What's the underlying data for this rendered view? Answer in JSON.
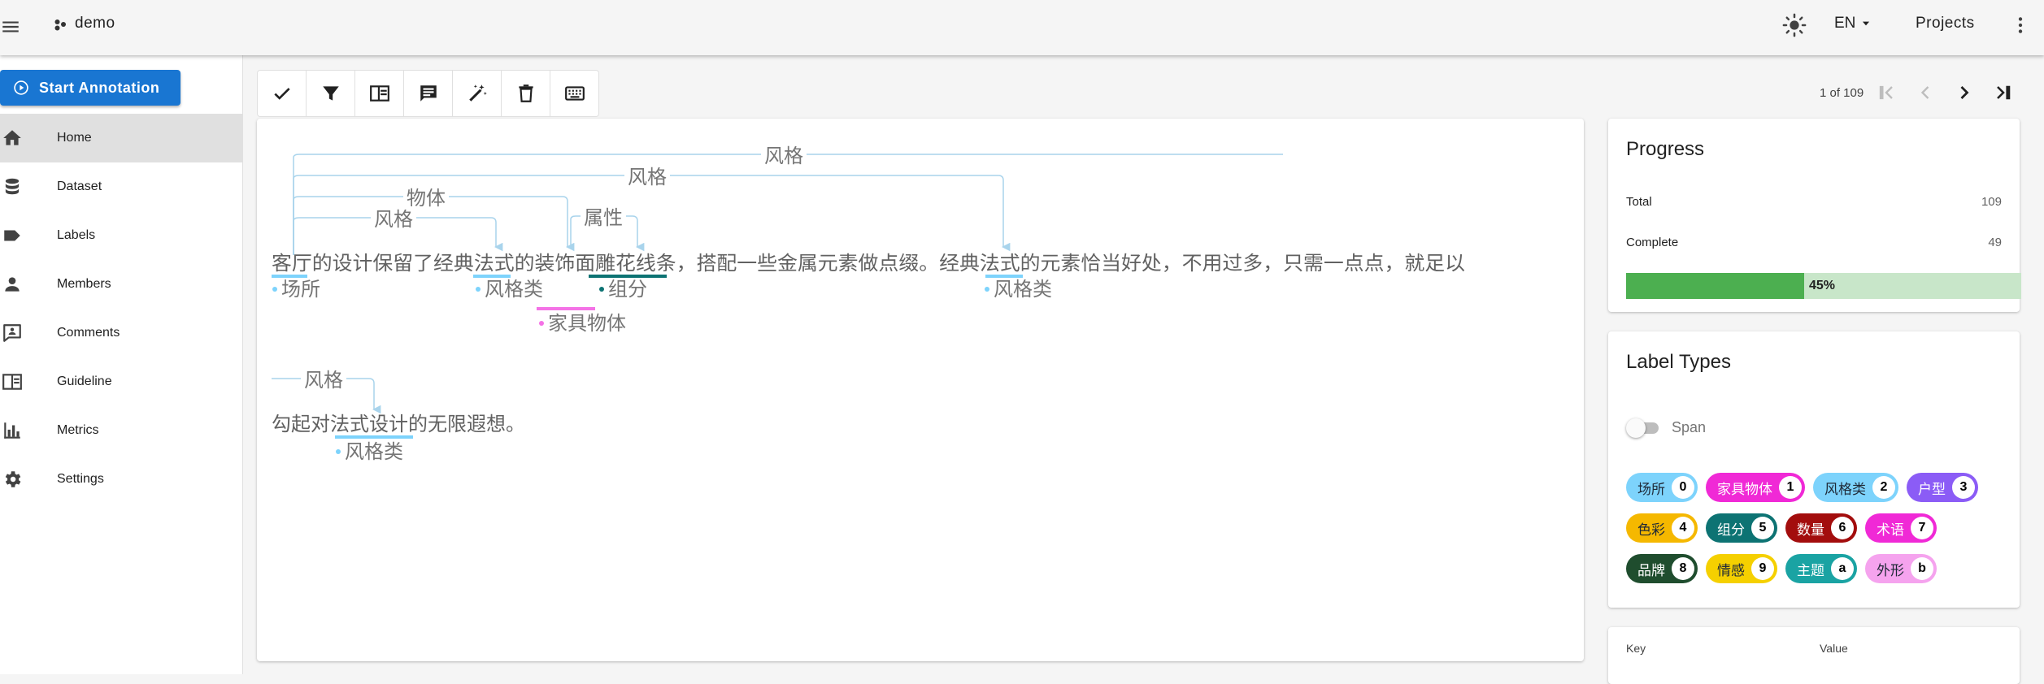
{
  "app": {
    "name": "demo"
  },
  "header": {
    "language": "EN",
    "projects_label": "Projects"
  },
  "sidebar": {
    "start_button": "Start Annotation",
    "items": [
      {
        "label": "Home",
        "icon": "home-icon",
        "active": true
      },
      {
        "label": "Dataset",
        "icon": "database-icon"
      },
      {
        "label": "Labels",
        "icon": "label-icon"
      },
      {
        "label": "Members",
        "icon": "person-icon"
      },
      {
        "label": "Comments",
        "icon": "comment-icon"
      },
      {
        "label": "Guideline",
        "icon": "book-icon"
      },
      {
        "label": "Metrics",
        "icon": "chart-icon"
      },
      {
        "label": "Settings",
        "icon": "gear-icon"
      }
    ]
  },
  "toolbar": {
    "tools": [
      "check-icon",
      "filter-icon",
      "layout-icon",
      "comment-icon",
      "auto-label-icon",
      "delete-icon",
      "keyboard-icon"
    ]
  },
  "pager": {
    "text": "1 of 109"
  },
  "document": {
    "line1": "客厅的设计保留了经典法式的装饰面雕花线条，搭配一些金属元素做点缀。经典法式的元素恰当好处，不用过多，只需一点点，就足以",
    "line2": "勾起对法式设计的无限遐想。",
    "spans": [
      {
        "text": "客厅",
        "label": "场所",
        "color": "#7dd3fc"
      },
      {
        "text": "法式",
        "label": "风格类",
        "color": "#7dd3fc"
      },
      {
        "text": "装饰面",
        "label": "家具物体",
        "color": "#f472e6"
      },
      {
        "text": "雕花线条",
        "label": "组分",
        "color": "#0d7373"
      },
      {
        "text": "法式",
        "label": "风格类",
        "color": "#7dd3fc"
      },
      {
        "text": "法式设计",
        "label": "风格类",
        "color": "#7dd3fc"
      }
    ],
    "relations": [
      {
        "label": "风格"
      },
      {
        "label": "风格"
      },
      {
        "label": "物体"
      },
      {
        "label": "风格"
      },
      {
        "label": "属性"
      },
      {
        "label": "风格"
      }
    ]
  },
  "progress": {
    "title": "Progress",
    "total_label": "Total",
    "total_value": "109",
    "complete_label": "Complete",
    "complete_value": "49",
    "percent": 45,
    "percent_label": "45%",
    "fill_color": "#4caf50",
    "track_color": "#c8e6c9"
  },
  "label_types": {
    "title": "Label Types",
    "toggle_label": "Span",
    "chips": [
      {
        "name": "场所",
        "key": "0",
        "bg": "#7dd3fc",
        "fg": "#1f2937"
      },
      {
        "name": "家具物体",
        "key": "1",
        "bg": "#f029d6",
        "fg": "#ffffff"
      },
      {
        "name": "风格类",
        "key": "2",
        "bg": "#7dd3fc",
        "fg": "#1f2937"
      },
      {
        "name": "户型",
        "key": "3",
        "bg": "#8b5cf6",
        "fg": "#ffffff"
      },
      {
        "name": "色彩",
        "key": "4",
        "bg": "#f5b800",
        "fg": "#1f2937"
      },
      {
        "name": "组分",
        "key": "5",
        "bg": "#0d7373",
        "fg": "#ffffff"
      },
      {
        "name": "数量",
        "key": "6",
        "bg": "#a30d0d",
        "fg": "#ffffff"
      },
      {
        "name": "术语",
        "key": "7",
        "bg": "#f029d6",
        "fg": "#ffffff"
      },
      {
        "name": "品牌",
        "key": "8",
        "bg": "#1f4d2e",
        "fg": "#ffffff"
      },
      {
        "name": "情感",
        "key": "9",
        "bg": "#f5d000",
        "fg": "#1f2937"
      },
      {
        "name": "主题",
        "key": "a",
        "bg": "#1aa3a3",
        "fg": "#ffffff"
      },
      {
        "name": "外形",
        "key": "b",
        "bg": "#f5a3ee",
        "fg": "#1f2937"
      }
    ]
  },
  "metadata": {
    "key_header": "Key",
    "value_header": "Value"
  }
}
